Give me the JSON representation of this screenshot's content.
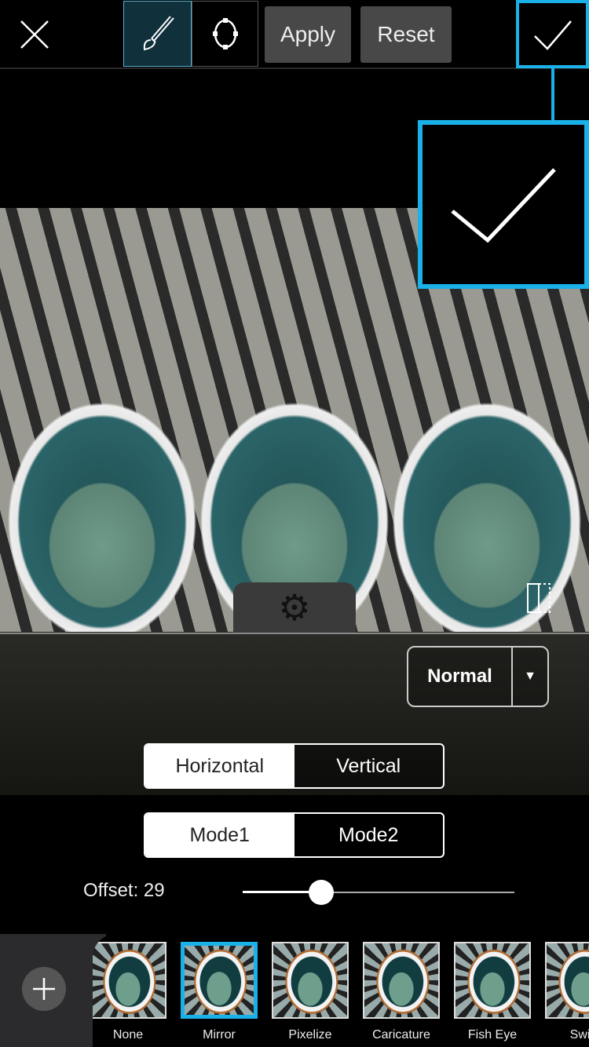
{
  "toolbar": {
    "close_icon": "close-icon",
    "brush_icon": "brush-icon",
    "shape_icon": "ellipse-select-icon",
    "apply_label": "Apply",
    "reset_label": "Reset",
    "confirm_icon": "checkmark-icon",
    "accent": "#1ab0e8"
  },
  "canvas": {
    "settings_icon": "gear-icon",
    "compare_icon": "split-compare-icon",
    "blend_mode": "Normal"
  },
  "direction": {
    "options": [
      "Horizontal",
      "Vertical"
    ],
    "selected": "Horizontal"
  },
  "mode": {
    "options": [
      "Mode1",
      "Mode2"
    ],
    "selected": "Mode1"
  },
  "offset": {
    "label": "Offset: 29",
    "value": 29,
    "min": 0,
    "max": 100
  },
  "effects": {
    "add_icon": "plus-icon",
    "items": [
      {
        "label": "None"
      },
      {
        "label": "Mirror",
        "selected": true
      },
      {
        "label": "Pixelize"
      },
      {
        "label": "Caricature"
      },
      {
        "label": "Fish Eye"
      },
      {
        "label": "Swirl"
      }
    ]
  }
}
